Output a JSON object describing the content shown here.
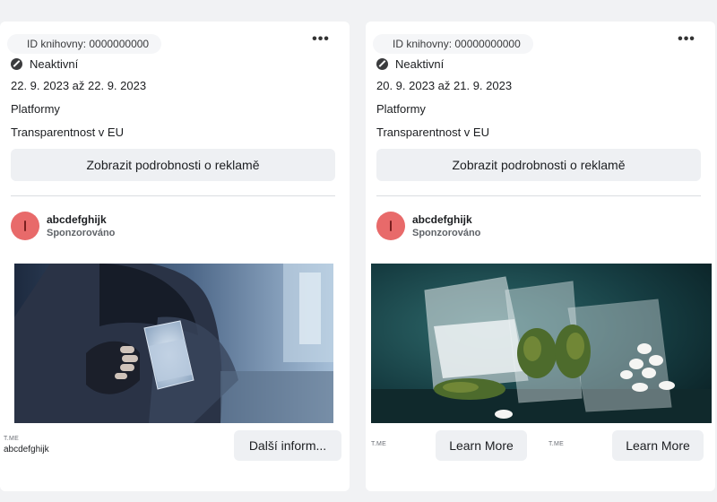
{
  "ads": [
    {
      "library_id": "ID knihovny: 0000000000",
      "status": "Neaktivní",
      "dates": "22. 9. 2023 až 22. 9. 2023",
      "platforms_label": "Platformy",
      "transparency_label": "Transparentnost v EU",
      "details_button": "Zobrazit podrobnosti o reklamě",
      "page_name": "abcdefghijk",
      "sponsored": "Sponzorováno",
      "caption_domain": "T.ME",
      "caption_name": "abcdefghijk",
      "cta": "Další inform..."
    },
    {
      "library_id": "ID knihovny: 00000000000",
      "status": "Neaktivní",
      "dates": "20. 9. 2023 až 21. 9. 2023",
      "platforms_label": "Platformy",
      "transparency_label": "Transparentnost v EU",
      "details_button": "Zobrazit podrobnosti o reklamě",
      "page_name": "abcdefghijk",
      "sponsored": "Sponzorováno",
      "carousel": [
        {
          "caption_domain": "T.ME",
          "cta": "Learn More"
        },
        {
          "caption_domain": "T.ME",
          "cta": "Learn More"
        }
      ]
    }
  ],
  "more_icon": "more-dots-icon",
  "colors": {
    "avatar": "#e86a6a",
    "button_bg": "#eef0f3",
    "page_bg": "#f1f2f4"
  }
}
